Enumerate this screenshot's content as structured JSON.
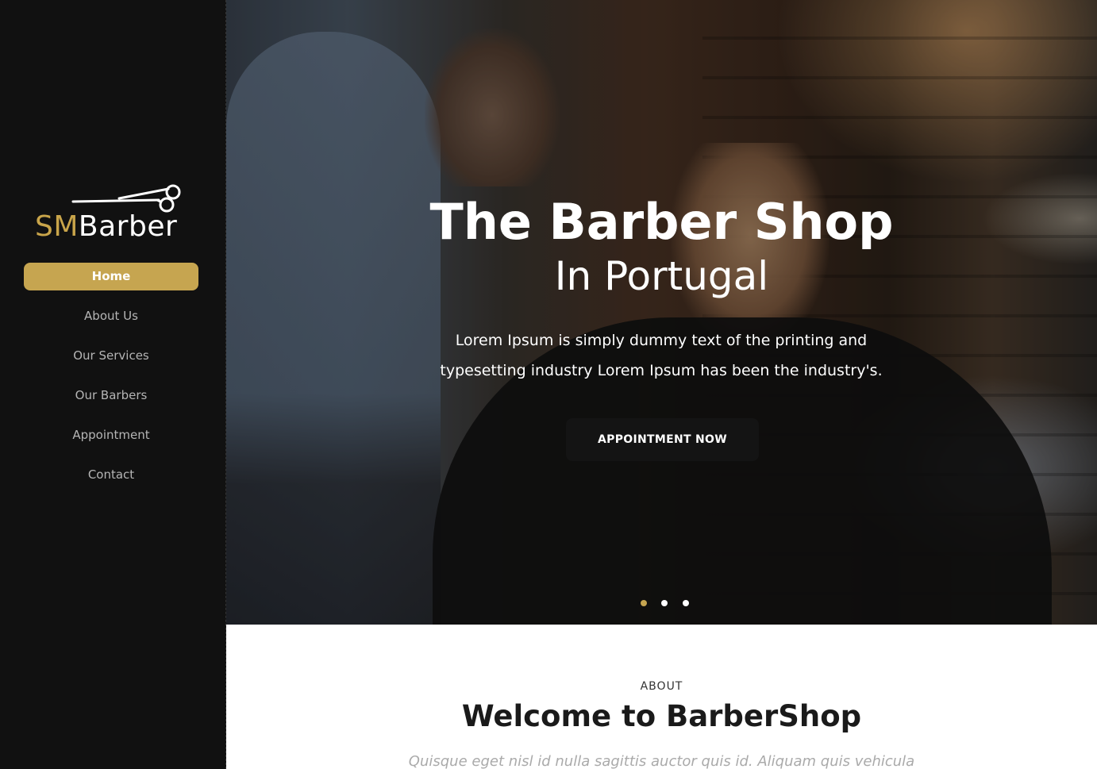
{
  "brand": {
    "part1": "SM",
    "part2": "Barber",
    "accent_color": "#c6a550",
    "icon": "scissors-icon"
  },
  "nav": {
    "items": [
      {
        "label": "Home",
        "active": true
      },
      {
        "label": "About Us",
        "active": false
      },
      {
        "label": "Our Services",
        "active": false
      },
      {
        "label": "Our Barbers",
        "active": false
      },
      {
        "label": "Appointment",
        "active": false
      },
      {
        "label": "Contact",
        "active": false
      }
    ]
  },
  "hero": {
    "title": "The Barber Shop",
    "subtitle": "In Portugal",
    "text": "Lorem Ipsum is simply dummy text of the printing and typesetting industry Lorem Ipsum has been the industry's.",
    "cta_label": "APPOINTMENT NOW",
    "slides": 3,
    "active_slide": 1
  },
  "about": {
    "label": "ABOUT",
    "title": "Welcome to BarberShop",
    "text": "Quisque eget nisl id nulla sagittis auctor quis id. Aliquam quis vehicula"
  },
  "colors": {
    "sidebar_bg": "#111111",
    "accent": "#c6a550",
    "button_bg": "#141414"
  }
}
